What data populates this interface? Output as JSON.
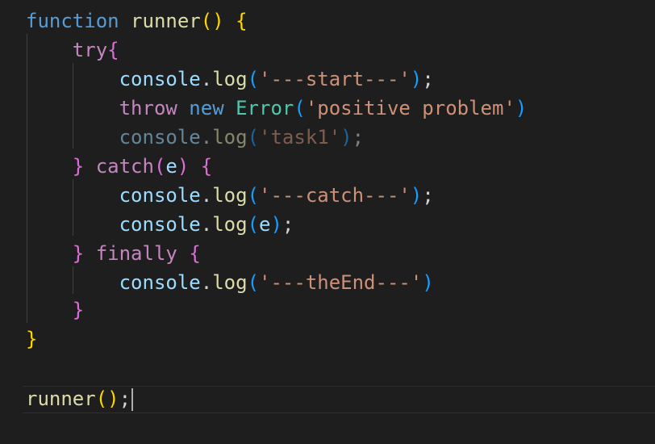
{
  "editor": {
    "language": "javascript",
    "theme_background": "#1e1e1e",
    "lines": {
      "l1": {
        "kw": "function",
        "name": "runner",
        "paren": "()",
        "brace": "{"
      },
      "l2": {
        "kw": "try",
        "brace": "{"
      },
      "l3": {
        "obj": "console",
        "dot": ".",
        "method": "log",
        "open": "(",
        "arg": "'---start---'",
        "close": ")",
        "semi": ";"
      },
      "l4": {
        "kw1": "throw",
        "kw2": "new",
        "cls": "Error",
        "open": "(",
        "arg": "'positive problem'",
        "close": ")"
      },
      "l5": {
        "obj": "console",
        "dot": ".",
        "method": "log",
        "open": "(",
        "arg": "'task1'",
        "close": ")",
        "semi": ";"
      },
      "l6": {
        "close": "}",
        "kw": "catch",
        "open": "(",
        "param": "e",
        "pclose": ")",
        "brace": "{"
      },
      "l7": {
        "obj": "console",
        "dot": ".",
        "method": "log",
        "open": "(",
        "arg": "'---catch---'",
        "close": ")",
        "semi": ";"
      },
      "l8": {
        "obj": "console",
        "dot": ".",
        "method": "log",
        "open": "(",
        "arg": "e",
        "close": ")",
        "semi": ";"
      },
      "l9": {
        "close": "}",
        "kw": "finally",
        "brace": "{"
      },
      "l10": {
        "obj": "console",
        "dot": ".",
        "method": "log",
        "open": "(",
        "arg": "'---theEnd---'",
        "close": ")"
      },
      "l11": {
        "close": "}"
      },
      "l12": {
        "close": "}"
      },
      "l14": {
        "name": "runner",
        "paren": "()",
        "semi": ";"
      }
    },
    "colors": {
      "keyword": "#569cd6",
      "function": "#dcdcaa",
      "control": "#c586c0",
      "variable": "#9cdcfe",
      "string": "#ce9178",
      "class": "#4ec9b0",
      "bracket_level1": "#ffd700",
      "bracket_level2": "#da70d6",
      "bracket_level3": "#179fff"
    }
  }
}
